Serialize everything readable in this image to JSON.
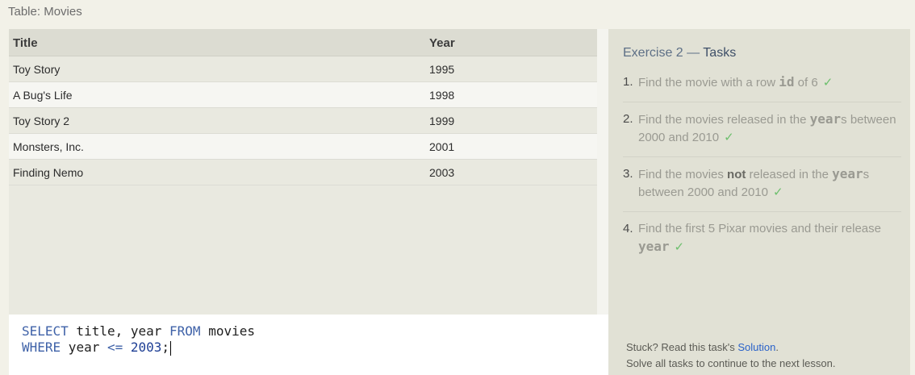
{
  "table": {
    "title": "Table: Movies",
    "columns": [
      "Title",
      "Year"
    ],
    "rows": [
      {
        "title": "Toy Story",
        "year": "1995"
      },
      {
        "title": "A Bug's Life",
        "year": "1998"
      },
      {
        "title": "Toy Story 2",
        "year": "1999"
      },
      {
        "title": "Monsters, Inc.",
        "year": "2001"
      },
      {
        "title": "Finding Nemo",
        "year": "2003"
      }
    ]
  },
  "editor": {
    "line1": {
      "kw1": "SELECT",
      "t1": " title, year ",
      "kw2": "FROM",
      "t2": " movies"
    },
    "line2": {
      "kw1": "WHERE",
      "t1": " year ",
      "op": "<=",
      "t2": " ",
      "num": "2003",
      "t3": ";"
    }
  },
  "exercise": {
    "heading_prefix": "Exercise 2 — ",
    "heading_tasks": "Tasks",
    "tasks": [
      {
        "num": "1.",
        "parts": [
          "Find the movie with a row ",
          "id",
          " of 6"
        ],
        "check": "✓"
      },
      {
        "num": "2.",
        "parts": [
          "Find the movies released in the ",
          "year",
          "s between 2000 and 2010"
        ],
        "check": "✓"
      },
      {
        "num": "3.",
        "parts": [
          "Find the movies ",
          "not",
          " released in the ",
          "year",
          "s between 2000 and 2010"
        ],
        "check": "✓"
      },
      {
        "num": "4.",
        "parts": [
          "Find the first 5 Pixar movies and their release ",
          "year"
        ],
        "check": "✓"
      }
    ]
  },
  "footer": {
    "stuck_prefix": "Stuck? Read this task's ",
    "solution_label": "Solution",
    "stuck_suffix": ".",
    "line2": "Solve all tasks to continue to the next lesson."
  },
  "colors": {
    "accent_link": "#2a62c9",
    "check_green": "#6dbf6d",
    "sql_keyword": "#3f62a8"
  }
}
